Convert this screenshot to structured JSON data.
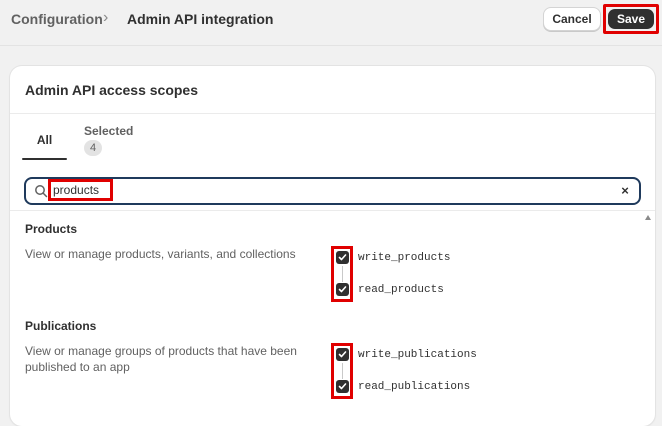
{
  "breadcrumb": {
    "parent": "Configuration",
    "separator": "›",
    "current": "Admin API integration"
  },
  "actions": {
    "cancel_label": "Cancel",
    "save_label": "Save"
  },
  "card": {
    "title": "Admin API access scopes"
  },
  "tabs": {
    "all_label": "All",
    "selected_label": "Selected",
    "selected_count": "4"
  },
  "search": {
    "value": "products",
    "clear_glyph": "×"
  },
  "sections": [
    {
      "title": "Products",
      "description": "View or manage products, variants, and collections",
      "scopes": [
        {
          "label": "write_products",
          "checked": true
        },
        {
          "label": "read_products",
          "checked": true
        }
      ]
    },
    {
      "title": "Publications",
      "description": "View or manage groups of products that have been published to an app",
      "scopes": [
        {
          "label": "write_publications",
          "checked": true
        },
        {
          "label": "read_publications",
          "checked": true
        }
      ]
    }
  ],
  "colors": {
    "highlight": "#e00000",
    "primary_button": "#303030",
    "search_border": "#1f3a5c"
  }
}
